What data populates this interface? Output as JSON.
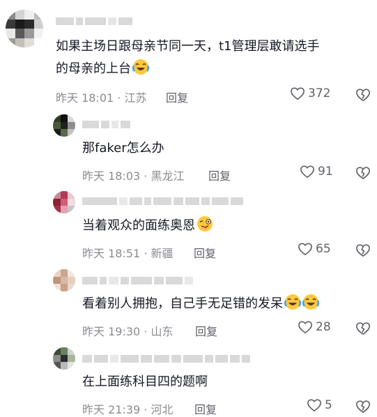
{
  "comments": [
    {
      "text": "如果主场日跟母亲节同一天，t1管理层敢请选手",
      "text_line2": "的母亲的上台",
      "emoji": "laughing-crying",
      "time_location": "昨天 18:01 · 江苏",
      "reply_label": "回复",
      "likes": "372"
    },
    {
      "text": "那faker怎么办",
      "time_location": "昨天 18:03 · 黑龙江",
      "reply_label": "回复",
      "likes": "91"
    },
    {
      "text": "当着观众的面练奥恩",
      "emoji": "tongue-out",
      "time_location": "昨天 18:51 · 新疆",
      "reply_label": "回复",
      "likes": "65"
    },
    {
      "text": "看着别人拥抱，自己手无足错的发呆",
      "emoji": "laughing-crying-x2",
      "time_location": "昨天 19:30 · 山东",
      "reply_label": "回复",
      "likes": "28"
    },
    {
      "text": "在上面练科目四的题啊",
      "time_location": "昨天 21:39 · 河北",
      "reply_label": "回复",
      "likes": "5"
    }
  ],
  "icons": {
    "like": "heart-outline-icon",
    "dislike": "broken-heart-icon"
  },
  "colors": {
    "text": "#161823",
    "meta": "#8a8b91",
    "action": "#5f6168"
  }
}
